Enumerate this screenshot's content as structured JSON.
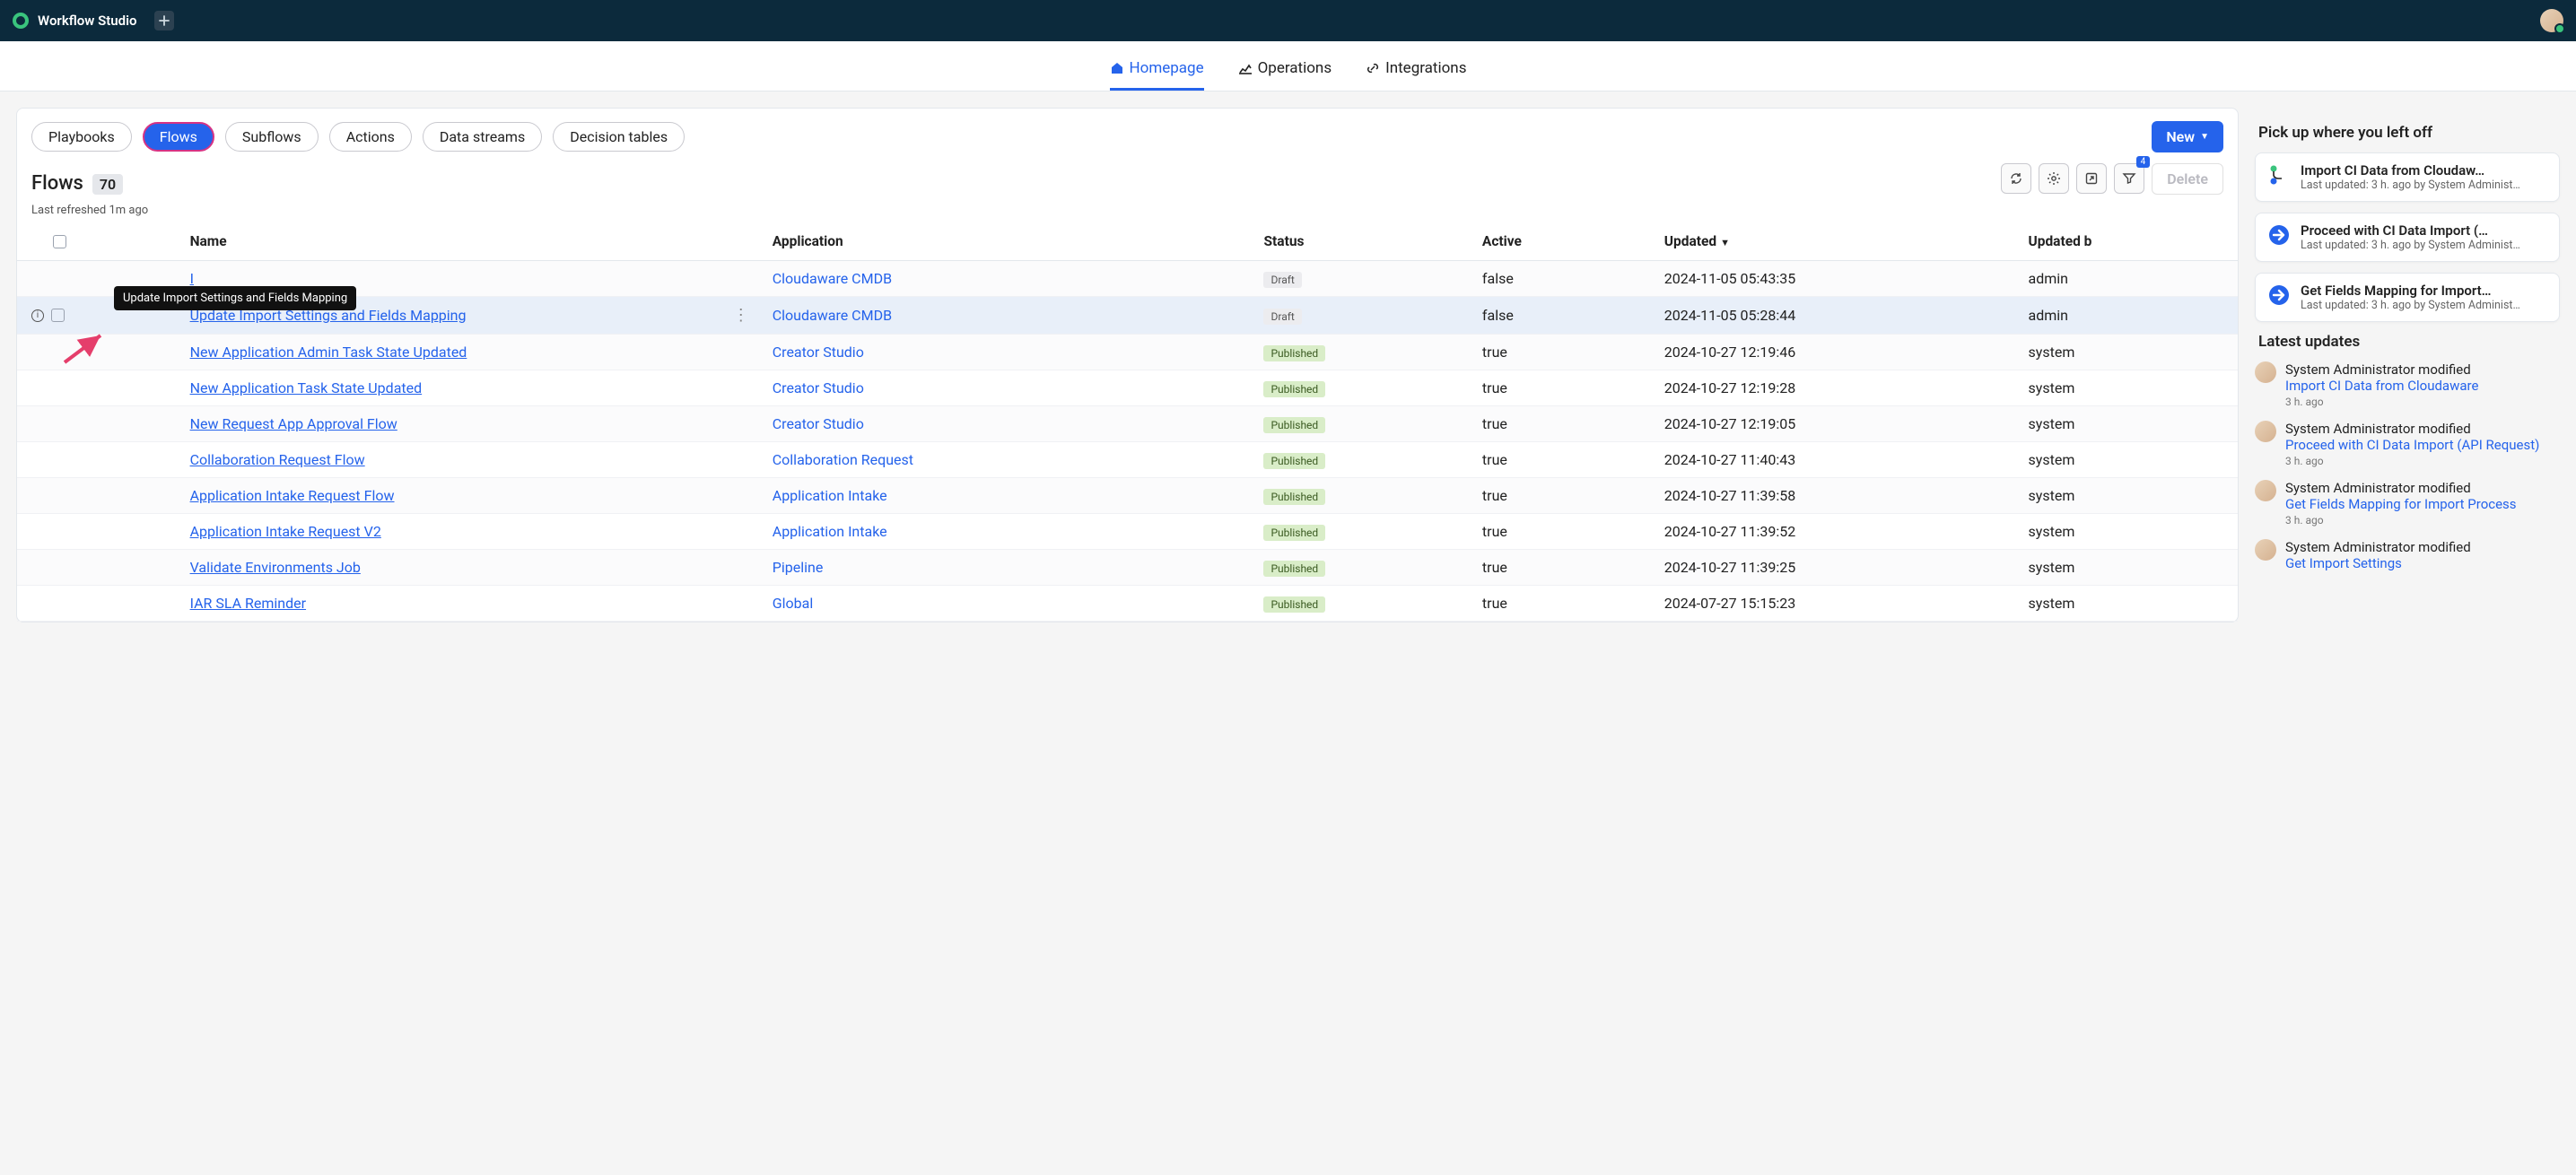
{
  "brand": "Workflow Studio",
  "nav": {
    "home": "Homepage",
    "ops": "Operations",
    "int": "Integrations"
  },
  "typeTabs": {
    "pb": "Playbooks",
    "fl": "Flows",
    "sf": "Subflows",
    "ac": "Actions",
    "ds": "Data streams",
    "dt": "Decision tables"
  },
  "newLabel": "New",
  "list": {
    "title": "Flows",
    "count": "70",
    "refresh": "Last refreshed 1m ago",
    "delete": "Delete",
    "filterBadge": "4"
  },
  "cols": {
    "name": "Name",
    "app": "Application",
    "status": "Status",
    "active": "Active",
    "upd": "Updated",
    "updby": "Updated b"
  },
  "tooltip": "Update Import Settings and Fields Mapping",
  "status": {
    "draft": "Draft",
    "pub": "Published"
  },
  "rows": [
    {
      "name": "I",
      "app": "Cloudaware CMDB",
      "status": "draft",
      "active": "false",
      "upd": "2024-11-05 05:43:35",
      "by": "admin"
    },
    {
      "name": "Update Import Settings and Fields Mapping",
      "app": "Cloudaware CMDB",
      "status": "draft",
      "active": "false",
      "upd": "2024-11-05 05:28:44",
      "by": "admin",
      "hl": true
    },
    {
      "name": "New Application Admin Task State Updated",
      "app": "Creator Studio",
      "status": "pub",
      "active": "true",
      "upd": "2024-10-27 12:19:46",
      "by": "system"
    },
    {
      "name": "New Application Task State Updated",
      "app": "Creator Studio",
      "status": "pub",
      "active": "true",
      "upd": "2024-10-27 12:19:28",
      "by": "system"
    },
    {
      "name": "New Request App Approval Flow",
      "app": "Creator Studio",
      "status": "pub",
      "active": "true",
      "upd": "2024-10-27 12:19:05",
      "by": "system"
    },
    {
      "name": "Collaboration Request Flow",
      "app": "Collaboration Request",
      "status": "pub",
      "active": "true",
      "upd": "2024-10-27 11:40:43",
      "by": "system"
    },
    {
      "name": "Application Intake Request Flow",
      "app": "Application Intake",
      "status": "pub",
      "active": "true",
      "upd": "2024-10-27 11:39:58",
      "by": "system"
    },
    {
      "name": "Application Intake Request V2",
      "app": "Application Intake",
      "status": "pub",
      "active": "true",
      "upd": "2024-10-27 11:39:52",
      "by": "system"
    },
    {
      "name": "Validate Environments Job",
      "app": "Pipeline",
      "status": "pub",
      "active": "true",
      "upd": "2024-10-27 11:39:25",
      "by": "system"
    },
    {
      "name": "IAR SLA Reminder",
      "app": "Global",
      "status": "pub",
      "active": "true",
      "upd": "2024-07-27 15:15:23",
      "by": "system"
    }
  ],
  "side": {
    "pickup": "Pick up where you left off",
    "recent": [
      {
        "title": "Import CI Data from Cloudaw…",
        "meta": "Last updated: 3 h. ago by System Administ…",
        "icon": "flow"
      },
      {
        "title": "Proceed with CI Data Import (…",
        "meta": "Last updated: 3 h. ago by System Administ…",
        "icon": "sub"
      },
      {
        "title": "Get Fields Mapping for Import…",
        "meta": "Last updated: 3 h. ago by System Administ…",
        "icon": "sub"
      }
    ],
    "latest": "Latest updates",
    "updates": [
      {
        "who": "System Administrator modified",
        "what": "Import CI Data from Cloudaware",
        "time": "3 h. ago"
      },
      {
        "who": "System Administrator modified",
        "what": "Proceed with CI Data Import (API Request)",
        "time": "3 h. ago"
      },
      {
        "who": "System Administrator modified",
        "what": "Get Fields Mapping for Import Process",
        "time": "3 h. ago"
      },
      {
        "who": "System Administrator modified",
        "what": "Get Import Settings",
        "time": ""
      }
    ]
  }
}
